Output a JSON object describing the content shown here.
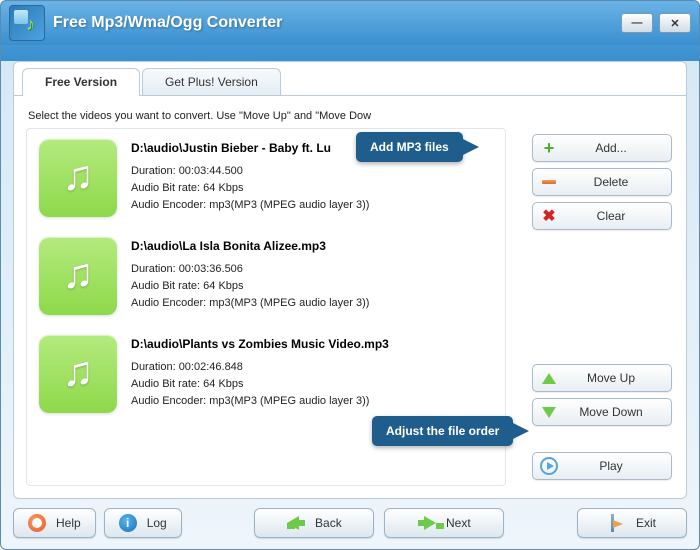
{
  "title": "Free Mp3/Wma/Ogg Converter",
  "window": {
    "minimize_glyph": "—",
    "close_glyph": "✕"
  },
  "tabs": {
    "free": "Free Version",
    "plus": "Get Plus! Version"
  },
  "instruction": "Select the videos you want to convert. Use \"Move Up\" and \"Move Dow",
  "files": [
    {
      "path": "D:\\audio\\Justin Bieber - Baby ft. Lu",
      "duration": "Duration: 00:03:44.500",
      "bitrate": "Audio Bit rate: 64 Kbps",
      "encoder": "Audio Encoder: mp3(MP3 (MPEG audio layer 3))"
    },
    {
      "path": "D:\\audio\\La Isla Bonita Alizee.mp3",
      "duration": "Duration: 00:03:36.506",
      "bitrate": "Audio Bit rate: 64 Kbps",
      "encoder": "Audio Encoder: mp3(MP3 (MPEG audio layer 3))"
    },
    {
      "path": "D:\\audio\\Plants vs Zombies Music Video.mp3",
      "duration": "Duration: 00:02:46.848",
      "bitrate": "Audio Bit rate: 64 Kbps",
      "encoder": "Audio Encoder: mp3(MP3 (MPEG audio layer 3))"
    }
  ],
  "side": {
    "add": "Add...",
    "delete": "Delete",
    "clear": "Clear",
    "moveup": "Move Up",
    "movedown": "Move Down",
    "play": "Play"
  },
  "callouts": {
    "add": "Add MP3 files",
    "order": "Adjust the file order"
  },
  "bottom": {
    "help": "Help",
    "log": "Log",
    "back": "Back",
    "next": "Next",
    "exit": "Exit"
  }
}
